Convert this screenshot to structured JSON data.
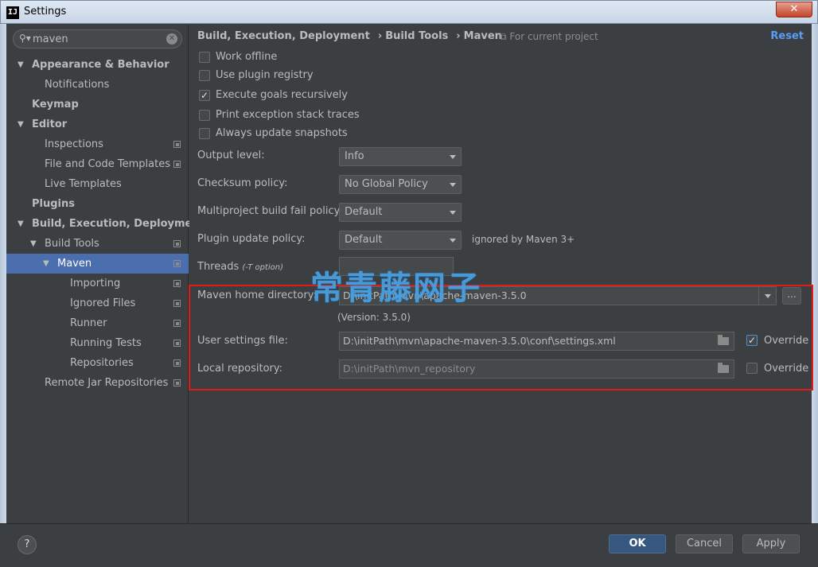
{
  "window": {
    "title": "Settings",
    "app_icon": "IJ",
    "close_glyph": "✕"
  },
  "sidebar": {
    "search": {
      "value": "maven",
      "icon": "search-icon"
    },
    "items": [
      {
        "label": "Appearance & Behavior",
        "level": 0,
        "bold": true,
        "arrow": "▼"
      },
      {
        "label": "Notifications",
        "level": 1,
        "bold": false,
        "arrow": ""
      },
      {
        "label": "Keymap",
        "level": 0,
        "bold": true,
        "arrow": ""
      },
      {
        "label": "Editor",
        "level": 0,
        "bold": true,
        "arrow": "▼"
      },
      {
        "label": "Inspections",
        "level": 1,
        "bold": false,
        "arrow": "",
        "copy": true
      },
      {
        "label": "File and Code Templates",
        "level": 1,
        "bold": false,
        "arrow": "",
        "copy": true
      },
      {
        "label": "Live Templates",
        "level": 1,
        "bold": false,
        "arrow": ""
      },
      {
        "label": "Plugins",
        "level": 0,
        "bold": true,
        "arrow": ""
      },
      {
        "label": "Build, Execution, Deployment",
        "level": 0,
        "bold": true,
        "arrow": "▼"
      },
      {
        "label": "Build Tools",
        "level": 1,
        "bold": false,
        "arrow": "▼",
        "copy": true
      },
      {
        "label": "Maven",
        "level": 2,
        "bold": false,
        "arrow": "▼",
        "copy": true,
        "selected": true
      },
      {
        "label": "Importing",
        "level": 3,
        "bold": false,
        "arrow": "",
        "copy": true
      },
      {
        "label": "Ignored Files",
        "level": 3,
        "bold": false,
        "arrow": "",
        "copy": true
      },
      {
        "label": "Runner",
        "level": 3,
        "bold": false,
        "arrow": "",
        "copy": true
      },
      {
        "label": "Running Tests",
        "level": 3,
        "bold": false,
        "arrow": "",
        "copy": true
      },
      {
        "label": "Repositories",
        "level": 3,
        "bold": false,
        "arrow": "",
        "copy": true
      },
      {
        "label": "Remote Jar Repositories",
        "level": 1,
        "bold": false,
        "arrow": "",
        "copy": true
      }
    ]
  },
  "main": {
    "breadcrumb": [
      "Build, Execution, Deployment",
      "Build Tools",
      "Maven"
    ],
    "breadcrumb_sep": "›",
    "for_project": "For current project",
    "reset": "Reset",
    "checkboxes": [
      {
        "label": "Work offline",
        "checked": false
      },
      {
        "label": "Use plugin registry",
        "checked": false
      },
      {
        "label": "Execute goals recursively",
        "checked": true
      },
      {
        "label": "Print exception stack traces",
        "checked": false
      },
      {
        "label": "Always update snapshots",
        "checked": false
      }
    ],
    "output_level": {
      "label": "Output level:",
      "value": "Info"
    },
    "checksum_policy": {
      "label": "Checksum policy:",
      "value": "No Global Policy"
    },
    "fail_policy": {
      "label": "Multiproject build fail policy:",
      "value": "Default"
    },
    "plugin_update": {
      "label": "Plugin update policy:",
      "value": "Default",
      "note": "ignored by Maven 3+"
    },
    "threads": {
      "label": "Threads",
      "hint": "(-T option)"
    },
    "maven_home": {
      "label": "Maven home directory:",
      "value": "D:\\initPath\\mvn\\apache-maven-3.5.0",
      "version": "(Version: 3.5.0)",
      "browse": "..."
    },
    "user_settings": {
      "label": "User settings file:",
      "value": "D:\\initPath\\mvn\\apache-maven-3.5.0\\conf\\settings.xml",
      "override_label": "Override",
      "override_checked": true
    },
    "local_repo": {
      "label": "Local repository:",
      "value": "D:\\initPath\\mvn_repository",
      "override_label": "Override",
      "override_checked": false
    },
    "watermark": "常青藤网子"
  },
  "footer": {
    "help": "?",
    "ok": "OK",
    "cancel": "Cancel",
    "apply": "Apply"
  },
  "colors": {
    "accent": "#4b6eaf",
    "link": "#589df6",
    "highlight_border": "#e31a1a",
    "background": "#3c3f41"
  }
}
